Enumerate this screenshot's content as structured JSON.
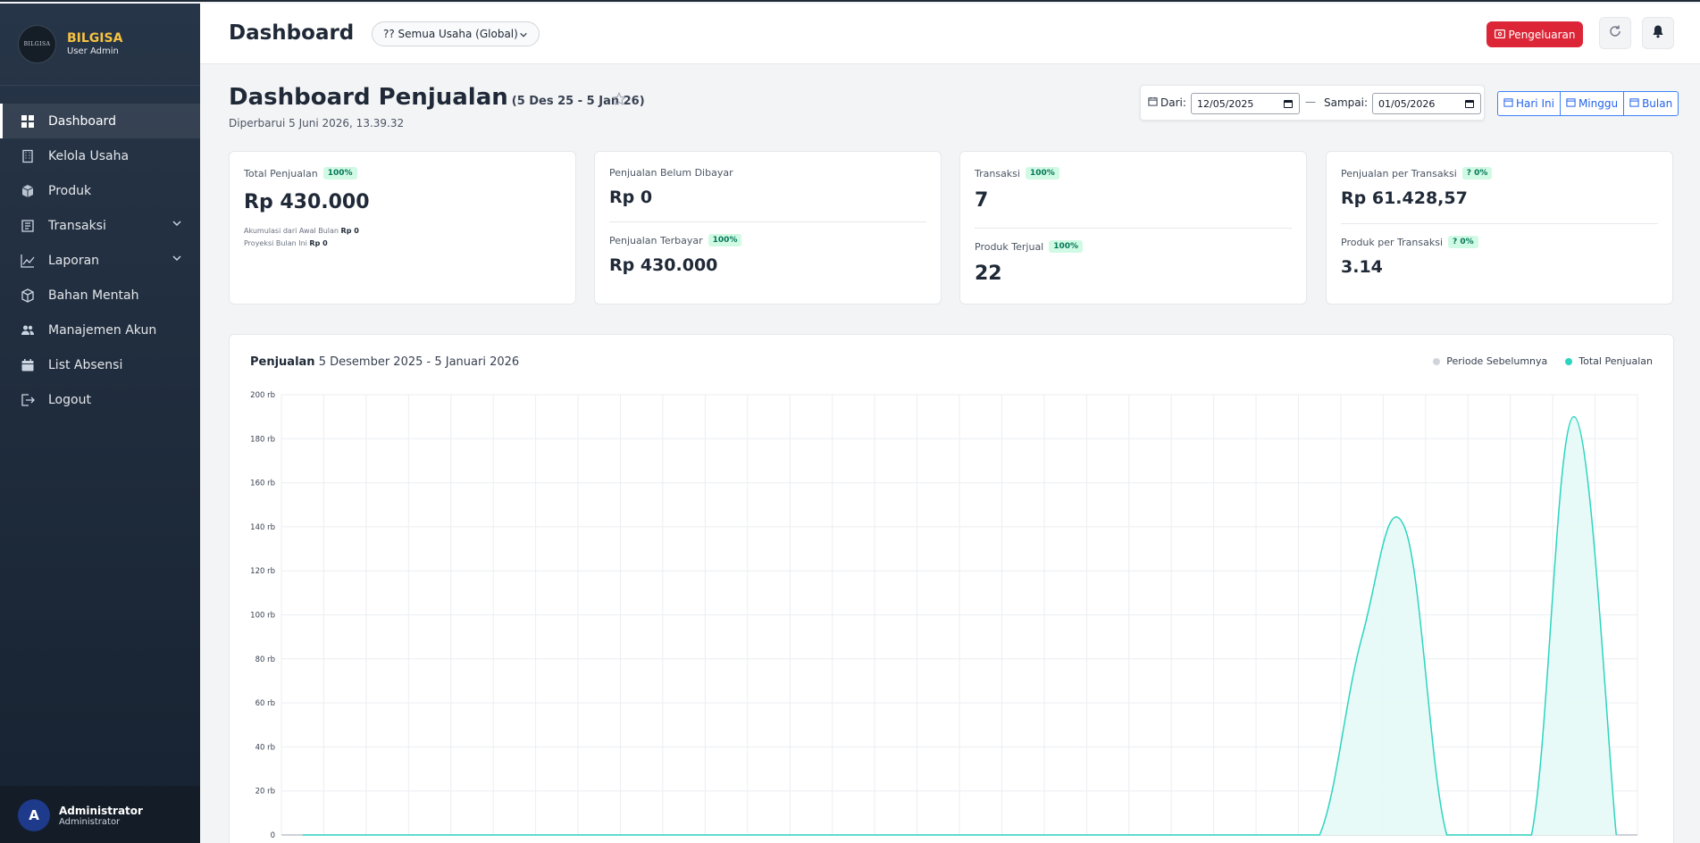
{
  "brand": {
    "name": "BILGISA",
    "role": "User Admin",
    "logo_text": "BILGISA"
  },
  "sidebar": {
    "items": [
      {
        "label": "Dashboard",
        "icon": "grid-icon",
        "active": true
      },
      {
        "label": "Kelola Usaha",
        "icon": "building-icon"
      },
      {
        "label": "Produk",
        "icon": "box-icon"
      },
      {
        "label": "Transaksi",
        "icon": "receipt-icon",
        "expandable": true
      },
      {
        "label": "Laporan",
        "icon": "chart-line-icon",
        "expandable": true
      },
      {
        "label": "Bahan Mentah",
        "icon": "package-icon"
      },
      {
        "label": "Manajemen Akun",
        "icon": "users-icon"
      },
      {
        "label": "List Absensi",
        "icon": "calendar-icon"
      },
      {
        "label": "Logout",
        "icon": "logout-icon"
      }
    ],
    "user": {
      "initial": "A",
      "name": "Administrator",
      "role": "Administrator"
    }
  },
  "topbar": {
    "title": "Dashboard",
    "business_select": "?? Semua Usaha (Global)",
    "expense_button": "Pengeluaran"
  },
  "page": {
    "title": "Dashboard Penjualan",
    "range": "(5 Des 25 - 5 Jan 26)",
    "updated": "Diperbarui 5 Juni 2026, 13.39.32"
  },
  "filters": {
    "from_label": "Dari:",
    "from_value": "12/05/2025",
    "to_label": "Sampai:",
    "to_value": "01/05/2026",
    "quick": [
      "Hari Ini",
      "Minggu",
      "Bulan"
    ]
  },
  "stats": {
    "total_sales": {
      "label": "Total Penjualan",
      "badge": "100%",
      "value": "Rp 430.000",
      "note1_label": "Akumulasi dari Awal Bulan",
      "note1_value": "Rp 0",
      "note2_label": "Proyeksi Bulan Ini",
      "note2_value": "Rp 0"
    },
    "unpaid": {
      "label": "Penjualan Belum Dibayar",
      "value": "Rp 0"
    },
    "paid": {
      "label": "Penjualan Terbayar",
      "badge": "100%",
      "value": "Rp 430.000"
    },
    "transactions": {
      "label": "Transaksi",
      "badge": "100%",
      "value": "7"
    },
    "products_sold": {
      "label": "Produk Terjual",
      "badge": "100%",
      "value": "22"
    },
    "sales_per_tx": {
      "label": "Penjualan per Transaksi",
      "badge": "? 0%",
      "value": "Rp 61.428,57"
    },
    "products_per_tx": {
      "label": "Produk per Transaksi",
      "badge": "? 0%",
      "value": "3.14"
    }
  },
  "chart_data": {
    "type": "area",
    "title": "Penjualan",
    "subtitle": "5 Desember 2025 - 5 Januari 2026",
    "y_tick_labels": [
      "0",
      "20 rb",
      "40 rb",
      "60 rb",
      "80 rb",
      "100 rb",
      "120 rb",
      "140 rb",
      "160 rb",
      "180 rb",
      "200 rb"
    ],
    "ylim": [
      0,
      200000
    ],
    "grid": true,
    "legend_position": "top-right",
    "legend": [
      "Periode Sebelumnya",
      "Total Penjualan"
    ],
    "x_count": 32,
    "series": [
      {
        "name": "Periode Sebelumnya",
        "color": "#d1d5db",
        "values": [
          0,
          0,
          0,
          0,
          0,
          0,
          0,
          0,
          0,
          0,
          0,
          0,
          0,
          0,
          0,
          0,
          0,
          0,
          0,
          0,
          0,
          0,
          0,
          0,
          0,
          0,
          0,
          0,
          0,
          0,
          0,
          0
        ]
      },
      {
        "name": "Total Penjualan",
        "color": "#2dd4bf",
        "values": [
          0,
          0,
          0,
          0,
          0,
          0,
          0,
          0,
          0,
          0,
          0,
          0,
          0,
          0,
          0,
          0,
          0,
          0,
          0,
          0,
          0,
          0,
          0,
          0,
          0,
          90000,
          140000,
          0,
          0,
          0,
          190000,
          0
        ]
      }
    ],
    "colors": {
      "accent": "#dc2637",
      "line": "#2dd4bf",
      "fill": "#e6faf6"
    }
  }
}
